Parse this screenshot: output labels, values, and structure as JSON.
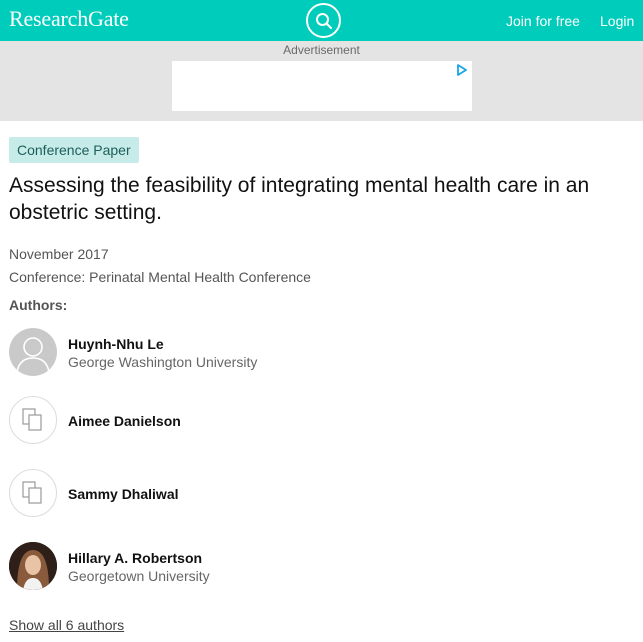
{
  "header": {
    "brand": "ResearchGate",
    "join_label": "Join for free",
    "login_label": "Login",
    "color": "#00ccbb"
  },
  "ad": {
    "label": "Advertisement"
  },
  "publication": {
    "type": "Conference Paper",
    "title": "Assessing the feasibility of integrating mental health care in an obstetric setting.",
    "date": "November 2017",
    "conference": "Conference: Perinatal Mental Health Conference"
  },
  "authors_heading": "Authors:",
  "authors": [
    {
      "name": "Huynh-Nhu Le",
      "institution": "George Washington University",
      "avatar": "default-person-icon"
    },
    {
      "name": "Aimee Danielson",
      "institution": "",
      "avatar": "placeholder-icon"
    },
    {
      "name": "Sammy Dhaliwal",
      "institution": "",
      "avatar": "placeholder-icon"
    },
    {
      "name": "Hillary A. Robertson",
      "institution": "Georgetown University",
      "avatar": "photo"
    }
  ],
  "show_all_label": "Show all 6 authors"
}
